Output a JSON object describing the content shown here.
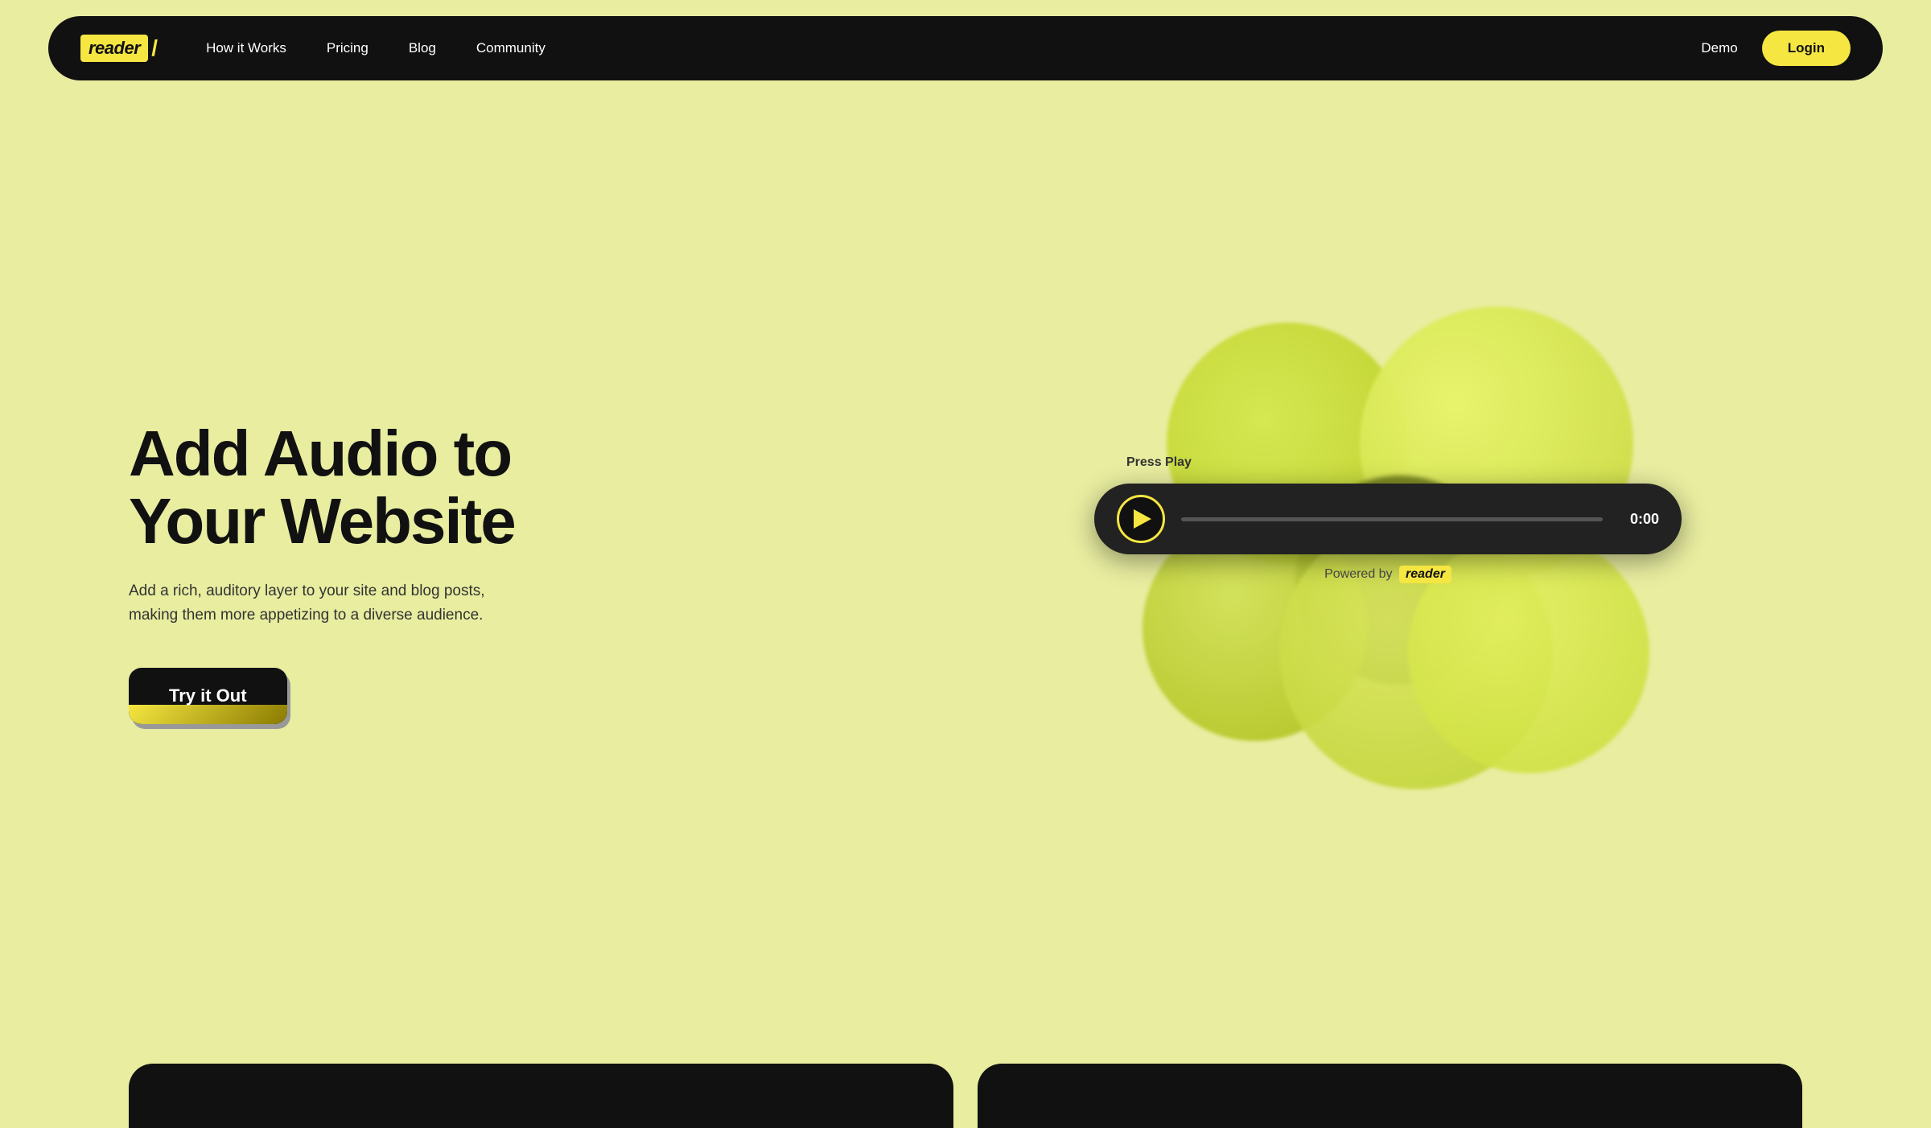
{
  "nav": {
    "logo_text": "reader",
    "logo_slash": "/",
    "links": [
      {
        "label": "How it Works",
        "id": "how-it-works"
      },
      {
        "label": "Pricing",
        "id": "pricing"
      },
      {
        "label": "Blog",
        "id": "blog"
      },
      {
        "label": "Community",
        "id": "community"
      }
    ],
    "demo_label": "Demo",
    "login_label": "Login"
  },
  "hero": {
    "title_line1": "Add Audio to",
    "title_line2": "Your Website",
    "description": "Add a rich, auditory layer to your site and blog posts, making them more appetizing to a diverse audience.",
    "cta_label": "Try it Out"
  },
  "player": {
    "press_play_label": "Press Play",
    "time": "0:00",
    "powered_by_text": "Powered by",
    "powered_by_brand": "reader"
  },
  "colors": {
    "bg": "#e8eda0",
    "accent": "#f5e642",
    "dark": "#111111"
  }
}
